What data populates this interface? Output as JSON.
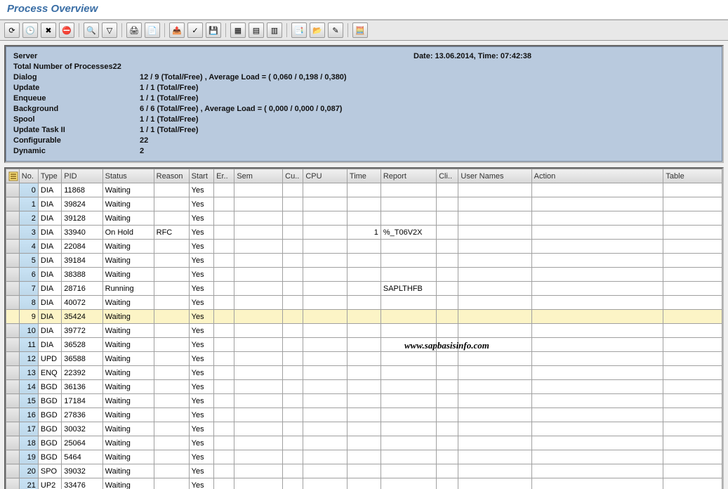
{
  "title": "Process Overview",
  "header": {
    "server_label": "Server",
    "total_label": "Total Number of Processes",
    "total_value": "22",
    "date_label": "Date: 13.06.2014, Time: 07:42:38",
    "rows": {
      "dialog": {
        "label": "Dialog",
        "value": "12 / 9 (Total/Free) , Average Load = ( 0,060 / 0,198 / 0,380)"
      },
      "update": {
        "label": "Update",
        "value": "1 / 1 (Total/Free)"
      },
      "enqueue": {
        "label": "Enqueue",
        "value": "1 / 1 (Total/Free)"
      },
      "background": {
        "label": "Background",
        "value": "6 / 6 (Total/Free) , Average Load = ( 0,000 / 0,000 / 0,087)"
      },
      "spool": {
        "label": "Spool",
        "value": "1 / 1 (Total/Free)"
      },
      "update2": {
        "label": "Update Task II",
        "value": "1 / 1 (Total/Free)"
      },
      "configurable": {
        "label": "Configurable",
        "value": "22"
      },
      "dynamic": {
        "label": "Dynamic",
        "value": "2"
      }
    }
  },
  "columns": {
    "no": "No.",
    "type": "Type",
    "pid": "PID",
    "status": "Status",
    "reason": "Reason",
    "start": "Start",
    "err": "Er..",
    "sem": "Sem",
    "cu": "Cu..",
    "cpu": "CPU",
    "time": "Time",
    "report": "Report",
    "cli": "Cli..",
    "user": "User Names",
    "action": "Action",
    "table": "Table"
  },
  "rows": [
    {
      "no": "0",
      "type": "DIA",
      "pid": "11868",
      "status": "Waiting",
      "reason": "",
      "start": "Yes",
      "err": "",
      "sem": "",
      "cu": "",
      "cpu": "",
      "time": "",
      "report": "",
      "cli": "",
      "user": "",
      "action": "",
      "table": ""
    },
    {
      "no": "1",
      "type": "DIA",
      "pid": "39824",
      "status": "Waiting",
      "reason": "",
      "start": "Yes",
      "err": "",
      "sem": "",
      "cu": "",
      "cpu": "",
      "time": "",
      "report": "",
      "cli": "",
      "user": "",
      "action": "",
      "table": ""
    },
    {
      "no": "2",
      "type": "DIA",
      "pid": "39128",
      "status": "Waiting",
      "reason": "",
      "start": "Yes",
      "err": "",
      "sem": "",
      "cu": "",
      "cpu": "",
      "time": "",
      "report": "",
      "cli": "",
      "user": "",
      "action": "",
      "table": ""
    },
    {
      "no": "3",
      "type": "DIA",
      "pid": "33940",
      "status": "On Hold",
      "reason": "RFC",
      "start": "Yes",
      "err": "",
      "sem": "",
      "cu": "",
      "cpu": "",
      "time": "1",
      "report": "%_T06V2X",
      "cli": "",
      "user": "",
      "action": "",
      "table": ""
    },
    {
      "no": "4",
      "type": "DIA",
      "pid": "22084",
      "status": "Waiting",
      "reason": "",
      "start": "Yes",
      "err": "",
      "sem": "",
      "cu": "",
      "cpu": "",
      "time": "",
      "report": "",
      "cli": "",
      "user": "",
      "action": "",
      "table": ""
    },
    {
      "no": "5",
      "type": "DIA",
      "pid": "39184",
      "status": "Waiting",
      "reason": "",
      "start": "Yes",
      "err": "",
      "sem": "",
      "cu": "",
      "cpu": "",
      "time": "",
      "report": "",
      "cli": "",
      "user": "",
      "action": "",
      "table": ""
    },
    {
      "no": "6",
      "type": "DIA",
      "pid": "38388",
      "status": "Waiting",
      "reason": "",
      "start": "Yes",
      "err": "",
      "sem": "",
      "cu": "",
      "cpu": "",
      "time": "",
      "report": "",
      "cli": "",
      "user": "",
      "action": "",
      "table": ""
    },
    {
      "no": "7",
      "type": "DIA",
      "pid": "28716",
      "status": "Running",
      "reason": "",
      "start": "Yes",
      "err": "",
      "sem": "",
      "cu": "",
      "cpu": "",
      "time": "",
      "report": "SAPLTHFB",
      "cli": "",
      "user": "",
      "action": "",
      "table": ""
    },
    {
      "no": "8",
      "type": "DIA",
      "pid": "40072",
      "status": "Waiting",
      "reason": "",
      "start": "Yes",
      "err": "",
      "sem": "",
      "cu": "",
      "cpu": "",
      "time": "",
      "report": "",
      "cli": "",
      "user": "",
      "action": "",
      "table": ""
    },
    {
      "no": "9",
      "type": "DIA",
      "pid": "35424",
      "status": "Waiting",
      "reason": "",
      "start": "Yes",
      "err": "",
      "sem": "",
      "cu": "",
      "cpu": "",
      "time": "",
      "report": "",
      "cli": "",
      "user": "",
      "action": "",
      "table": "",
      "selected": true
    },
    {
      "no": "10",
      "type": "DIA",
      "pid": "39772",
      "status": "Waiting",
      "reason": "",
      "start": "Yes",
      "err": "",
      "sem": "",
      "cu": "",
      "cpu": "",
      "time": "",
      "report": "",
      "cli": "",
      "user": "",
      "action": "",
      "table": ""
    },
    {
      "no": "11",
      "type": "DIA",
      "pid": "36528",
      "status": "Waiting",
      "reason": "",
      "start": "Yes",
      "err": "",
      "sem": "",
      "cu": "",
      "cpu": "",
      "time": "",
      "report": "",
      "cli": "",
      "user": "",
      "action": "",
      "table": ""
    },
    {
      "no": "12",
      "type": "UPD",
      "pid": "36588",
      "status": "Waiting",
      "reason": "",
      "start": "Yes",
      "err": "",
      "sem": "",
      "cu": "",
      "cpu": "",
      "time": "",
      "report": "",
      "cli": "",
      "user": "",
      "action": "",
      "table": ""
    },
    {
      "no": "13",
      "type": "ENQ",
      "pid": "22392",
      "status": "Waiting",
      "reason": "",
      "start": "Yes",
      "err": "",
      "sem": "",
      "cu": "",
      "cpu": "",
      "time": "",
      "report": "",
      "cli": "",
      "user": "",
      "action": "",
      "table": ""
    },
    {
      "no": "14",
      "type": "BGD",
      "pid": "36136",
      "status": "Waiting",
      "reason": "",
      "start": "Yes",
      "err": "",
      "sem": "",
      "cu": "",
      "cpu": "",
      "time": "",
      "report": "",
      "cli": "",
      "user": "",
      "action": "",
      "table": ""
    },
    {
      "no": "15",
      "type": "BGD",
      "pid": "17184",
      "status": "Waiting",
      "reason": "",
      "start": "Yes",
      "err": "",
      "sem": "",
      "cu": "",
      "cpu": "",
      "time": "",
      "report": "",
      "cli": "",
      "user": "",
      "action": "",
      "table": ""
    },
    {
      "no": "16",
      "type": "BGD",
      "pid": "27836",
      "status": "Waiting",
      "reason": "",
      "start": "Yes",
      "err": "",
      "sem": "",
      "cu": "",
      "cpu": "",
      "time": "",
      "report": "",
      "cli": "",
      "user": "",
      "action": "",
      "table": ""
    },
    {
      "no": "17",
      "type": "BGD",
      "pid": "30032",
      "status": "Waiting",
      "reason": "",
      "start": "Yes",
      "err": "",
      "sem": "",
      "cu": "",
      "cpu": "",
      "time": "",
      "report": "",
      "cli": "",
      "user": "",
      "action": "",
      "table": ""
    },
    {
      "no": "18",
      "type": "BGD",
      "pid": "25064",
      "status": "Waiting",
      "reason": "",
      "start": "Yes",
      "err": "",
      "sem": "",
      "cu": "",
      "cpu": "",
      "time": "",
      "report": "",
      "cli": "",
      "user": "",
      "action": "",
      "table": ""
    },
    {
      "no": "19",
      "type": "BGD",
      "pid": "5464",
      "status": "Waiting",
      "reason": "",
      "start": "Yes",
      "err": "",
      "sem": "",
      "cu": "",
      "cpu": "",
      "time": "",
      "report": "",
      "cli": "",
      "user": "",
      "action": "",
      "table": ""
    },
    {
      "no": "20",
      "type": "SPO",
      "pid": "39032",
      "status": "Waiting",
      "reason": "",
      "start": "Yes",
      "err": "",
      "sem": "",
      "cu": "",
      "cpu": "",
      "time": "",
      "report": "",
      "cli": "",
      "user": "",
      "action": "",
      "table": ""
    },
    {
      "no": "21",
      "type": "UP2",
      "pid": "33476",
      "status": "Waiting",
      "reason": "",
      "start": "Yes",
      "err": "",
      "sem": "",
      "cu": "",
      "cpu": "",
      "time": "",
      "report": "",
      "cli": "",
      "user": "",
      "action": "",
      "table": ""
    }
  ],
  "watermark": "www.sapbasisinfo.com",
  "icons": {
    "refresh": "⟳",
    "clock": "🕒",
    "cancel": "✖",
    "end": "⛔",
    "detail": "🔍",
    "filter": "▽",
    "print": "🖨",
    "printprev": "📄",
    "export": "📤",
    "abc": "✓",
    "save": "💾",
    "grid1": "▦",
    "grid2": "▤",
    "grid3": "▥",
    "tool1": "📑",
    "tool2": "📂",
    "tool3": "✎",
    "calc": "🧮"
  }
}
